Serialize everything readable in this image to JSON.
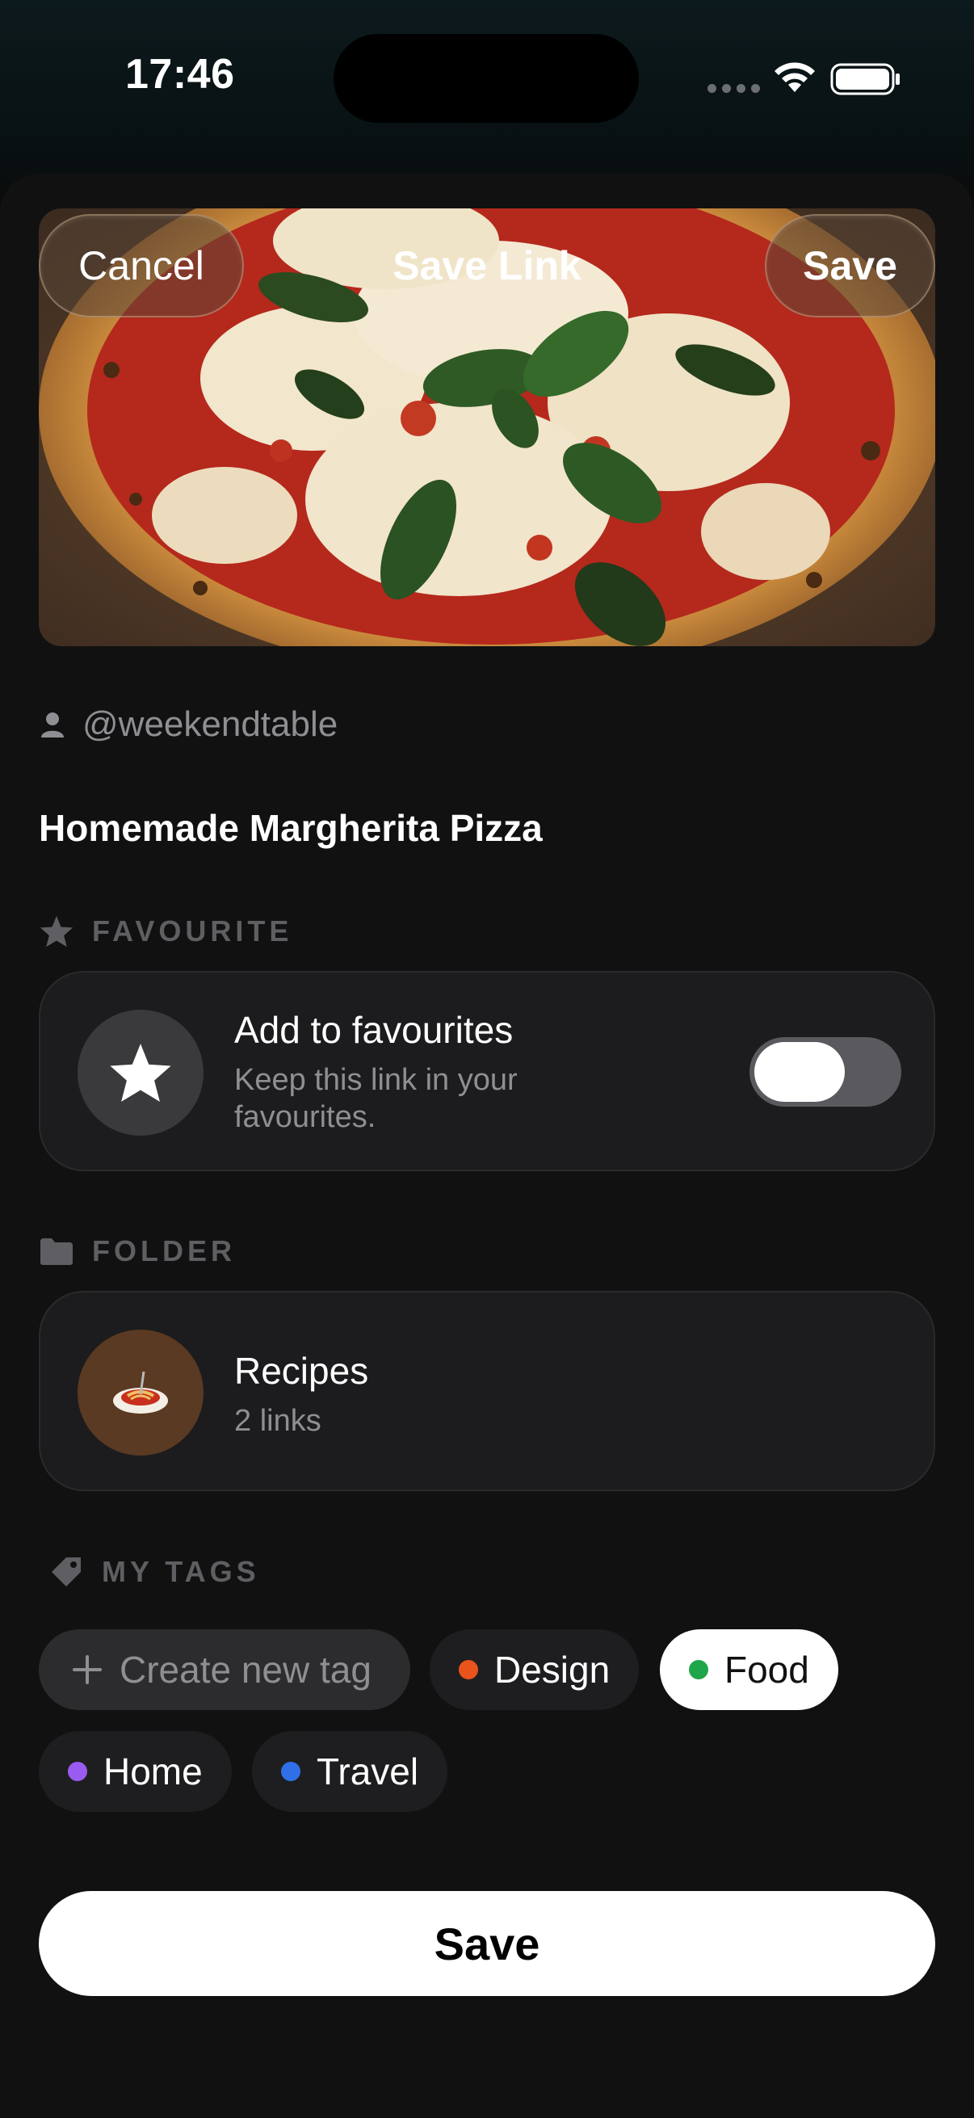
{
  "status_bar": {
    "time": "17:46"
  },
  "header": {
    "cancel_label": "Cancel",
    "title": "Save Link",
    "save_label": "Save"
  },
  "link": {
    "author": "@weekendtable",
    "title": "Homemade Margherita Pizza"
  },
  "favourite": {
    "section_label": "FAVOURITE",
    "title": "Add to favourites",
    "subtitle": "Keep this link in your favourites.",
    "enabled": false
  },
  "folder": {
    "section_label": "FOLDER",
    "name": "Recipes",
    "count": "2 links",
    "emoji": "🍝",
    "color": "#5a3a22"
  },
  "tags": {
    "section_label": "MY TAGS",
    "create_label": "Create new tag",
    "items": [
      {
        "label": "Design",
        "color": "#e8541c",
        "selected": false
      },
      {
        "label": "Food",
        "color": "#1fa64a",
        "selected": true
      },
      {
        "label": "Home",
        "color": "#9a5cf0",
        "selected": false
      },
      {
        "label": "Travel",
        "color": "#2f6fe8",
        "selected": false
      }
    ]
  },
  "footer": {
    "save_label": "Save"
  }
}
